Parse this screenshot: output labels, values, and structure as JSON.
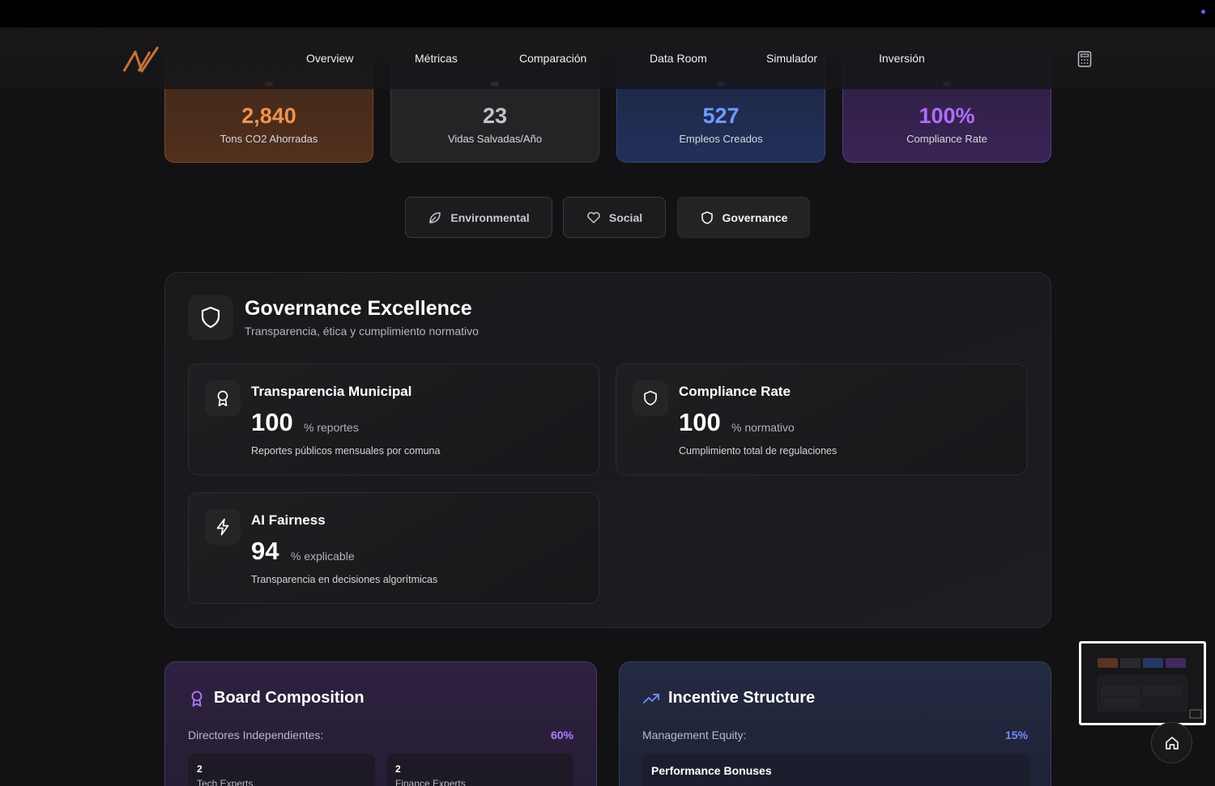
{
  "nav": {
    "items": [
      "Overview",
      "Métricas",
      "Comparación",
      "Data Room",
      "Simulador",
      "Inversión"
    ]
  },
  "stats": [
    {
      "value": "2,840",
      "label": "Tons CO2 Ahorradas",
      "color": "#f0924f"
    },
    {
      "value": "23",
      "label": "Vidas Salvadas/Año",
      "color": "#c4c4c8"
    },
    {
      "value": "527",
      "label": "Empleos Creados",
      "color": "#6f9bff"
    },
    {
      "value": "100%",
      "label": "Compliance Rate",
      "color": "#b06cff"
    }
  ],
  "tabs": [
    {
      "label": "Environmental",
      "icon": "leaf-icon"
    },
    {
      "label": "Social",
      "icon": "heart-icon"
    },
    {
      "label": "Governance",
      "icon": "shield-icon",
      "active": true
    }
  ],
  "governance": {
    "title": "Governance Excellence",
    "subtitle": "Transparencia, ética y cumplimiento normativo",
    "metrics": [
      {
        "title": "Transparencia Municipal",
        "value": "100",
        "unit": "% reportes",
        "desc": "Reportes públicos mensuales por comuna",
        "icon": "award-icon"
      },
      {
        "title": "Compliance Rate",
        "value": "100",
        "unit": "% normativo",
        "desc": "Cumplimiento total de regulaciones",
        "icon": "shield-icon"
      },
      {
        "title": "AI Fairness",
        "value": "94",
        "unit": "% explicable",
        "desc": "Transparencia en decisiones algorítmicas",
        "icon": "bolt-icon"
      }
    ]
  },
  "board": {
    "title": "Board Composition",
    "label": "Directores Independientes:",
    "percent": "60%",
    "percent_color": "#b07cff",
    "boxes": [
      {
        "num": "2",
        "label": "Tech Experts"
      },
      {
        "num": "2",
        "label": "Finance Experts"
      }
    ]
  },
  "incentive": {
    "title": "Incentive Structure",
    "label": "Management Equity:",
    "percent": "15%",
    "percent_color": "#6f8bff",
    "box_title": "Performance Bonuses"
  }
}
